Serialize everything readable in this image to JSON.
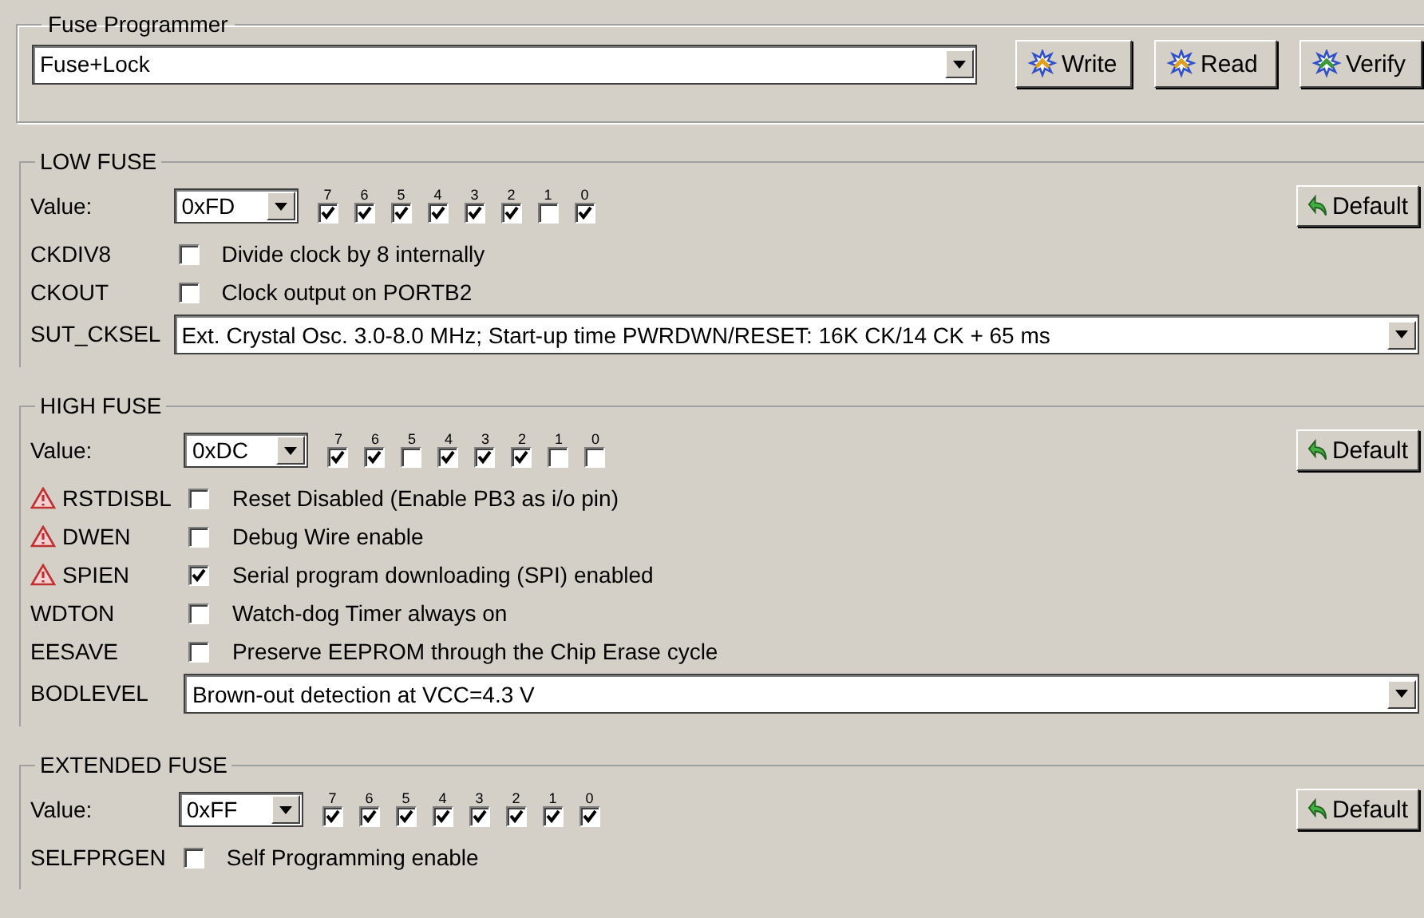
{
  "programmer": {
    "title": "Fuse Programmer",
    "mode": "Fuse+Lock",
    "buttons": [
      {
        "label": "Write"
      },
      {
        "label": "Read"
      },
      {
        "label": "Verify"
      }
    ]
  },
  "sections": [
    {
      "title": "LOW FUSE",
      "value_label": "Value:",
      "value": "0xFD",
      "default_button": "Default",
      "bits": [
        {
          "label": "7",
          "checked": true
        },
        {
          "label": "6",
          "checked": true
        },
        {
          "label": "5",
          "checked": true
        },
        {
          "label": "4",
          "checked": true
        },
        {
          "label": "3",
          "checked": true
        },
        {
          "label": "2",
          "checked": true
        },
        {
          "label": "1",
          "checked": false
        },
        {
          "label": "0",
          "checked": true
        }
      ],
      "rows": [
        {
          "kind": "checkbox",
          "name": "CKDIV8",
          "warning": false,
          "checked": false,
          "description": "Divide clock by 8 internally"
        },
        {
          "kind": "checkbox",
          "name": "CKOUT",
          "warning": false,
          "checked": false,
          "description": "Clock output on PORTB2"
        },
        {
          "kind": "select",
          "name": "SUT_CKSEL",
          "warning": false,
          "value": "Ext. Crystal Osc. 3.0-8.0 MHz; Start-up time PWRDWN/RESET: 16K CK/14 CK + 65 ms"
        }
      ]
    },
    {
      "title": "HIGH FUSE",
      "value_label": "Value:",
      "value": "0xDC",
      "default_button": "Default",
      "bits": [
        {
          "label": "7",
          "checked": true
        },
        {
          "label": "6",
          "checked": true
        },
        {
          "label": "5",
          "checked": false
        },
        {
          "label": "4",
          "checked": true
        },
        {
          "label": "3",
          "checked": true
        },
        {
          "label": "2",
          "checked": true
        },
        {
          "label": "1",
          "checked": false
        },
        {
          "label": "0",
          "checked": false
        }
      ],
      "rows": [
        {
          "kind": "checkbox",
          "name": "RSTDISBL",
          "warning": true,
          "checked": false,
          "description": "Reset Disabled (Enable PB3 as i/o pin)"
        },
        {
          "kind": "checkbox",
          "name": "DWEN",
          "warning": true,
          "checked": false,
          "description": "Debug Wire enable"
        },
        {
          "kind": "checkbox",
          "name": "SPIEN",
          "warning": true,
          "checked": true,
          "description": "Serial program downloading (SPI) enabled"
        },
        {
          "kind": "checkbox",
          "name": "WDTON",
          "warning": false,
          "checked": false,
          "description": "Watch-dog Timer always on"
        },
        {
          "kind": "checkbox",
          "name": "EESAVE",
          "warning": false,
          "checked": false,
          "description": "Preserve EEPROM through the Chip Erase cycle"
        },
        {
          "kind": "select",
          "name": "BODLEVEL",
          "warning": false,
          "value": "Brown-out detection at VCC=4.3 V"
        }
      ]
    },
    {
      "title": "EXTENDED FUSE",
      "value_label": "Value:",
      "value": "0xFF",
      "default_button": "Default",
      "bits": [
        {
          "label": "7",
          "checked": true
        },
        {
          "label": "6",
          "checked": true
        },
        {
          "label": "5",
          "checked": true
        },
        {
          "label": "4",
          "checked": true
        },
        {
          "label": "3",
          "checked": true
        },
        {
          "label": "2",
          "checked": true
        },
        {
          "label": "1",
          "checked": true
        },
        {
          "label": "0",
          "checked": true
        }
      ],
      "rows": [
        {
          "kind": "checkbox",
          "name": "SELFPRGEN",
          "warning": false,
          "checked": false,
          "description": "Self Programming enable"
        }
      ]
    }
  ]
}
